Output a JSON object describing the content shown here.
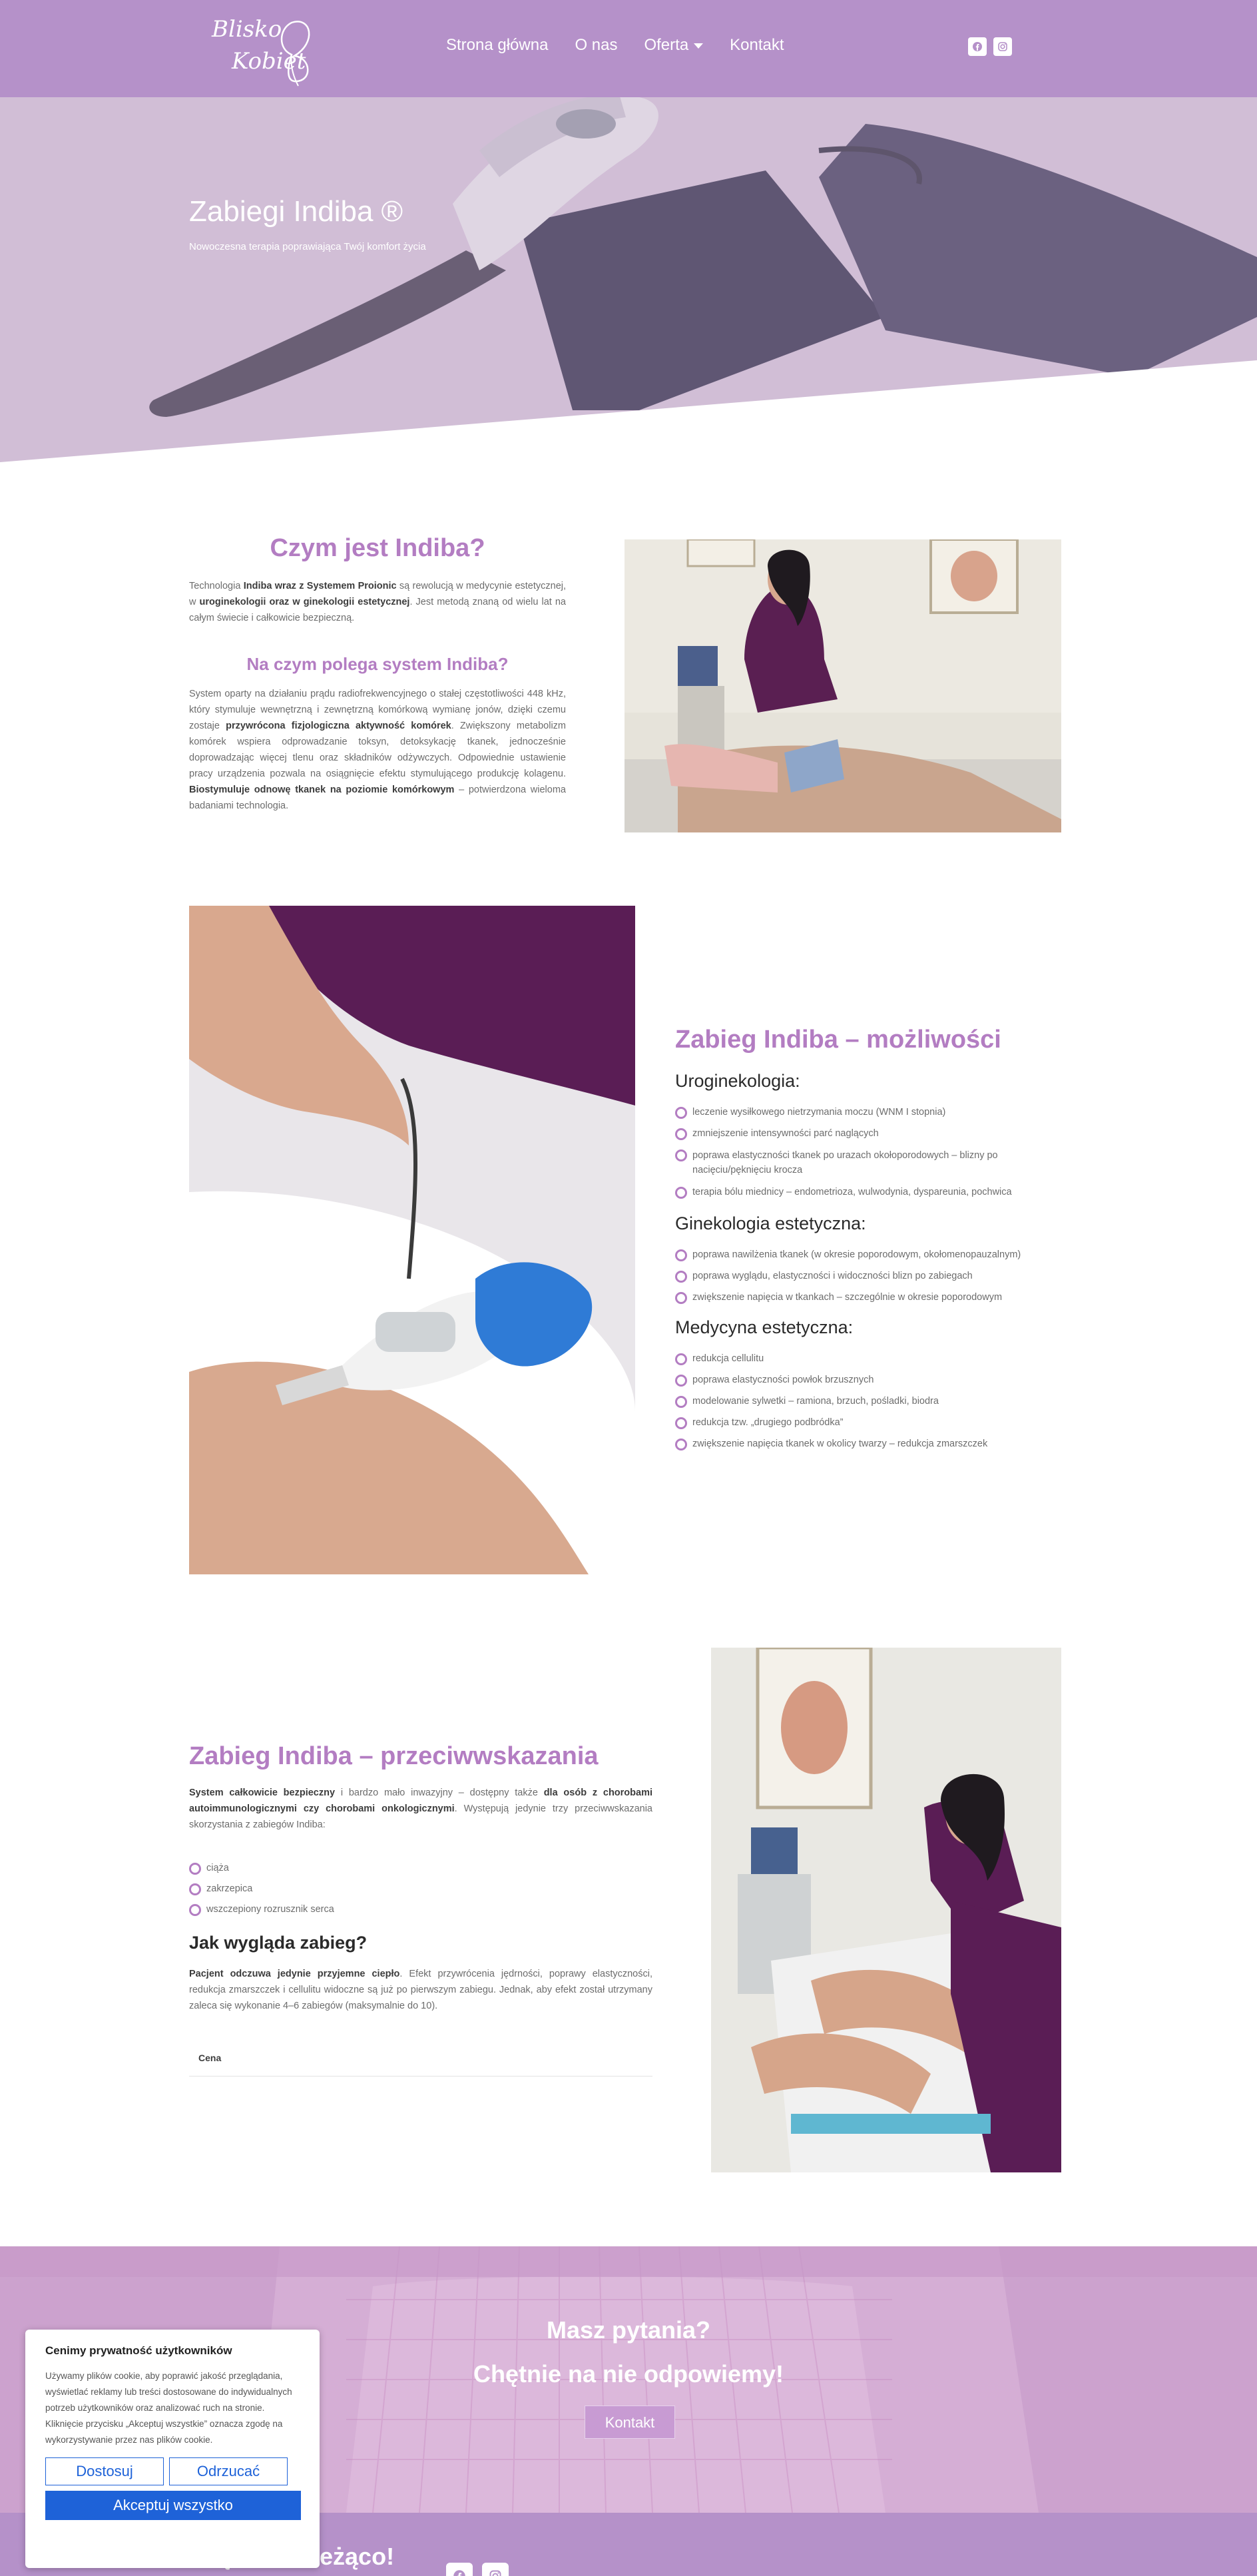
{
  "header": {
    "logo_line1": "Blisko",
    "logo_line2": "Kobiet",
    "nav": [
      {
        "label": "Strona główna"
      },
      {
        "label": "O nas"
      },
      {
        "label": "Oferta"
      },
      {
        "label": "Kontakt"
      }
    ],
    "social_icons": [
      "facebook-icon",
      "instagram-icon"
    ]
  },
  "hero": {
    "title": "Zabiegi Indiba ®",
    "subtitle": "Nowoczesna terapia poprawiająca Twój komfort życia"
  },
  "section1": {
    "title": "Czym jest Indiba?",
    "p1": [
      {
        "t": "Technologia "
      },
      {
        "t": "Indiba wraz z Systemem Proionic",
        "b": true
      },
      {
        "t": " są rewolucją w medycynie estetycznej, w "
      },
      {
        "t": "uroginekologii oraz w ginekologii estetycznej",
        "b": true
      },
      {
        "t": ". Jest metodą znaną od wielu lat na całym świecie i całkowicie bezpieczną."
      }
    ],
    "subtitle": "Na czym polega system Indiba?",
    "p2": [
      {
        "t": "System oparty na działaniu prądu radiofrekwencyjnego o stałej częstotliwości 448 kHz, który stymuluje wewnętrzną i zewnętrzną komórkową wymianę jonów, dzięki czemu zostaje "
      },
      {
        "t": "przywrócona fizjologiczna aktywność komórek",
        "b": true
      },
      {
        "t": ". Zwiększony metabolizm komórek wspiera odprowadzanie toksyn, detoksykację tkanek, jednocześnie doprowadzając więcej tlenu oraz składników odżywczych. Odpowiednie ustawienie pracy urządzenia pozwala na osiągnięcie efektu stymulującego produkcję kolagenu. "
      },
      {
        "t": "Biostymuluje odnowę tkanek na poziomie komórkowym",
        "b": true
      },
      {
        "t": " – potwierdzona wieloma badaniami technologia."
      }
    ]
  },
  "section2": {
    "title": "Zabieg Indiba – możliwości",
    "cat1": "Uroginekologia:",
    "list1": [
      "leczenie wysiłkowego nietrzymania moczu (WNM I stopnia)",
      "zmniejszenie intensywności parć naglących",
      "poprawa elastyczności tkanek po urazach okołoporodowych – blizny po nacięciu/pęknięciu krocza",
      "terapia bólu miednicy – endometrioza, wulwodynia, dyspareunia, pochwica"
    ],
    "cat2": "Ginekologia estetyczna:",
    "list2": [
      "poprawa nawilżenia tkanek (w okresie poporodowym, okołomenopauzalnym)",
      "poprawa wyglądu, elastyczności i widoczności blizn po zabiegach",
      "zwiększenie napięcia w tkankach – szczególnie w okresie poporodowym"
    ],
    "cat3": "Medycyna estetyczna:",
    "list3": [
      "redukcja cellulitu",
      "poprawa elastyczności powłok brzusznych",
      "modelowanie sylwetki – ramiona, brzuch, pośladki, biodra",
      "redukcja tzw. „drugiego podbródka”",
      "zwiększenie napięcia tkanek w okolicy twarzy – redukcja zmarszczek"
    ]
  },
  "section3": {
    "title": "Zabieg Indiba – przeciwwskazania",
    "p1": [
      {
        "t": "System całkowicie bezpieczny",
        "b": true
      },
      {
        "t": " i bardzo mało inwazyjny – dostępny także "
      },
      {
        "t": "dla osób z chorobami autoimmunologicznymi czy chorobami onkologicznymi",
        "b": true
      },
      {
        "t": ". Występują jedynie trzy przeciwwskazania skorzystania z zabiegów Indiba:"
      }
    ],
    "list": [
      "ciąża",
      "zakrzepica",
      "wszczepiony rozrusznik serca"
    ],
    "h3": "Jak wygląda zabieg?",
    "p2": [
      {
        "t": "Pacjent odczuwa jedynie przyjemne ciepło",
        "b": true
      },
      {
        "t": ". Efekt przywrócenia jędrności, poprawy elastyczności, redukcja zmarszczek i cellulitu widoczne są już po pierwszym zabiegu. Jednak, aby efekt został utrzymany zaleca się wykonanie 4–6 zabiegów (maksymalnie do 10)."
      }
    ],
    "tab_label": "Cena"
  },
  "cta": {
    "line1": "Masz pytania?",
    "line2": "Chętnie na nie odpowiemy!",
    "button": "Kontakt"
  },
  "footer": {
    "title": "Bądź na bieżąco!"
  },
  "cookie": {
    "title": "Cenimy prywatność użytkowników",
    "text": "Używamy plików cookie, aby poprawić jakość przeglądania, wyświetlać reklamy lub treści dostosowane do indywidualnych potrzeb użytkowników oraz analizować ruch na stronie. Kliknięcie przycisku „Akceptuj wszystkie” oznacza zgodę na wykorzystywanie przez nas plików cookie.",
    "customize": "Dostosuj",
    "reject": "Odrzucać",
    "accept": "Akceptuj wszystko"
  },
  "colors": {
    "brand_purple": "#b591c9",
    "heading_purple": "#b37dc2",
    "cookie_blue": "#1e62d8"
  }
}
